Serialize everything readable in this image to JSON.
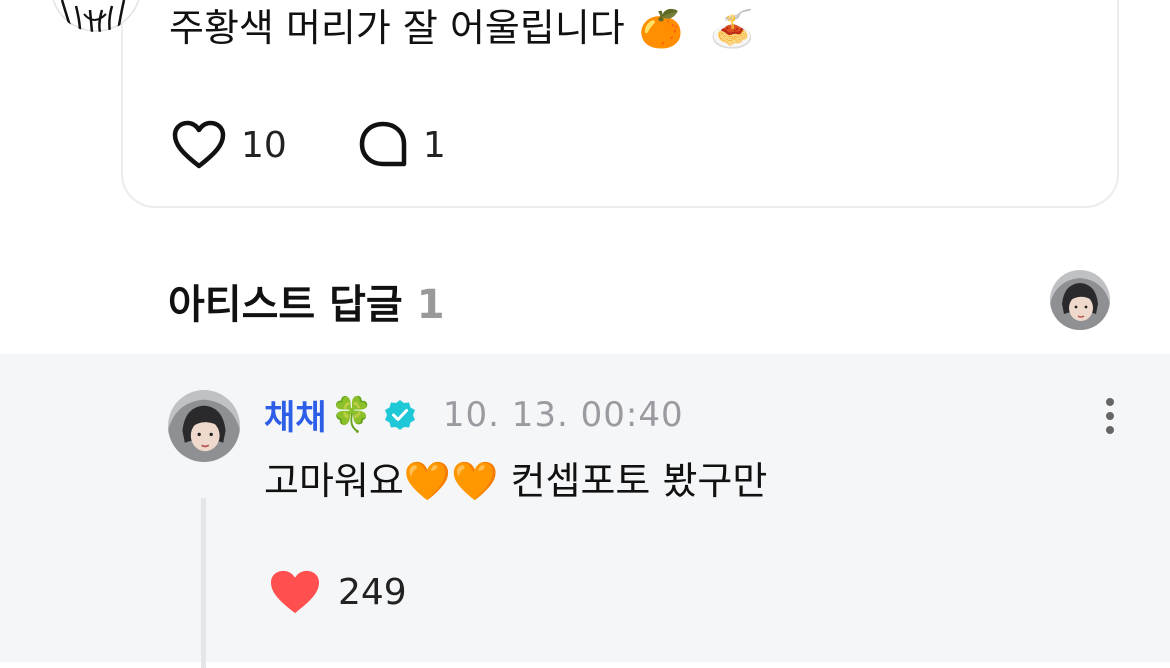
{
  "post": {
    "text": "주황색 머리가 잘 어울립니다",
    "emoji_1": "🍊",
    "emoji_2": "🍝",
    "like_count": "10",
    "comment_count": "1"
  },
  "artist_replies": {
    "title": "아티스트 답글",
    "count": "1"
  },
  "reply": {
    "author": "채채",
    "author_emoji": "🍀",
    "timestamp": "10. 13. 00:40",
    "text": "고마워요🧡🧡 컨셉포토 봤구만",
    "like_count": "249"
  },
  "colors": {
    "author_blue": "#2c5ee8",
    "verified_teal": "#1ec8d6",
    "heart_red": "#ff4f4f",
    "reply_bg": "#f5f6f8"
  },
  "icons": [
    "heart-outline-icon",
    "comment-bubble-icon",
    "verified-badge-icon",
    "more-vertical-icon",
    "heart-filled-icon"
  ]
}
